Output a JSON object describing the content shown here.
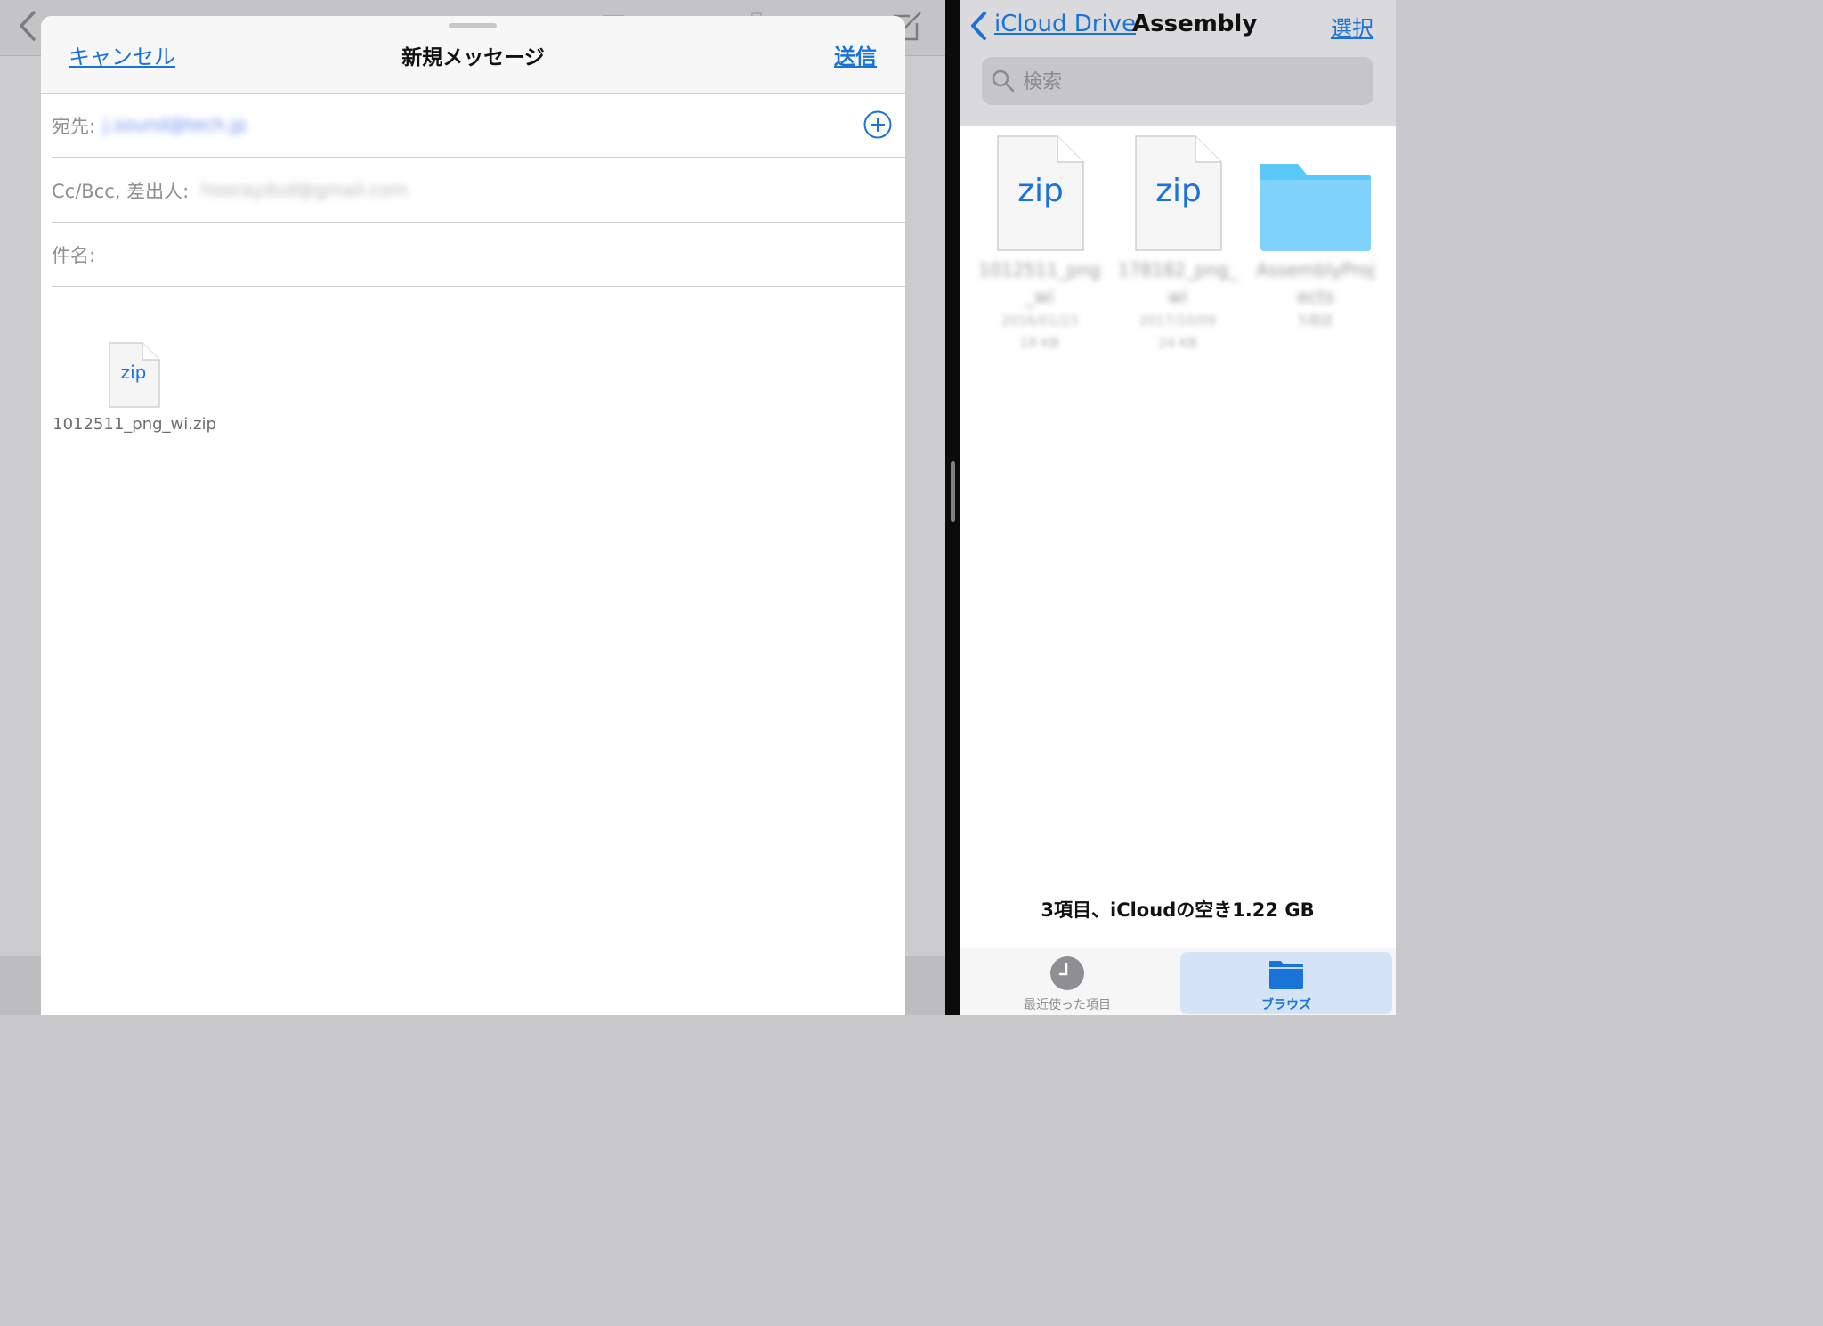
{
  "colors": {
    "accent": "#1a73d9",
    "folder": "#5ac8fa",
    "divider": "#0b0b0c",
    "sheet_header": "#f7f7f7"
  },
  "compose": {
    "cancel_label": "キャンセル",
    "title": "新規メッセージ",
    "send_label": "送信",
    "to_label": "宛先:",
    "to_value": "j.sound@tech.jp",
    "cc_label": "Cc/Bcc, 差出人:",
    "cc_value": "hooraydud@gmail.com",
    "subject_label": "件名:",
    "subject_value": "",
    "add_recipient_icon": "plus-circle-icon",
    "attachment": {
      "icon": "zip-file-icon",
      "icon_text": "zip",
      "name": "1012511_png_wi.zip"
    }
  },
  "files": {
    "back_label": "iCloud Drive",
    "folder_title": "Assembly",
    "select_label": "選択",
    "search_placeholder": "検索",
    "items": [
      {
        "type": "zip",
        "icon_text": "zip",
        "name": "1012511_png_wi",
        "date": "2016/01/23",
        "size": "18 KB"
      },
      {
        "type": "zip",
        "icon_text": "zip",
        "name": "178182_png_wi",
        "date": "2017/10/09",
        "size": "24 KB"
      },
      {
        "type": "folder",
        "name": "AssemblyProjects",
        "count": "5項目"
      }
    ],
    "status": "3項目、iCloudの空き1.22 GB",
    "tabs": [
      {
        "label": "最近使った項目",
        "icon": "clock-icon",
        "selected": false
      },
      {
        "label": "ブラウズ",
        "icon": "folder-icon",
        "selected": true
      }
    ]
  }
}
